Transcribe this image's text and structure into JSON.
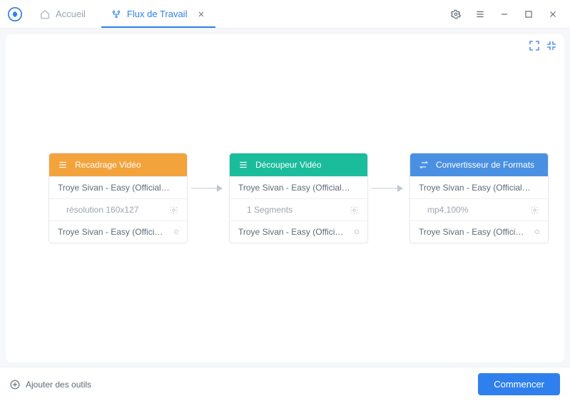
{
  "titlebar": {
    "tabs": [
      {
        "label": "Accueil",
        "icon": "home-icon"
      },
      {
        "label": "Flux de Travail",
        "icon": "workflow-icon"
      }
    ]
  },
  "colors": {
    "orange": "#f3a33c",
    "teal": "#1abc9c",
    "blue": "#4a90e2",
    "primary": "#2f80ed"
  },
  "workflow": {
    "cards": [
      {
        "color": "#f3a33c",
        "title": "Recadrage Vidéo",
        "icon": "list-icon",
        "input": "Troye Sivan - Easy (Official…",
        "setting": "résolution 160x127",
        "output": "Troye Sivan - Easy (Offici…"
      },
      {
        "color": "#1abc9c",
        "title": "Découpeur Vidéo",
        "icon": "list-icon",
        "input": "Troye Sivan - Easy (Official…",
        "setting": "1 Segments",
        "output": "Troye Sivan - Easy (Offici…"
      },
      {
        "color": "#4a90e2",
        "title": "Convertisseur de Formats",
        "icon": "swap-icon",
        "input": "Troye Sivan - Easy (Official…",
        "setting": "mp4,100%",
        "output": "Troye Sivan - Easy (Offici…"
      }
    ]
  },
  "footer": {
    "add_label": "Ajouter des outils",
    "start_label": "Commencer"
  }
}
